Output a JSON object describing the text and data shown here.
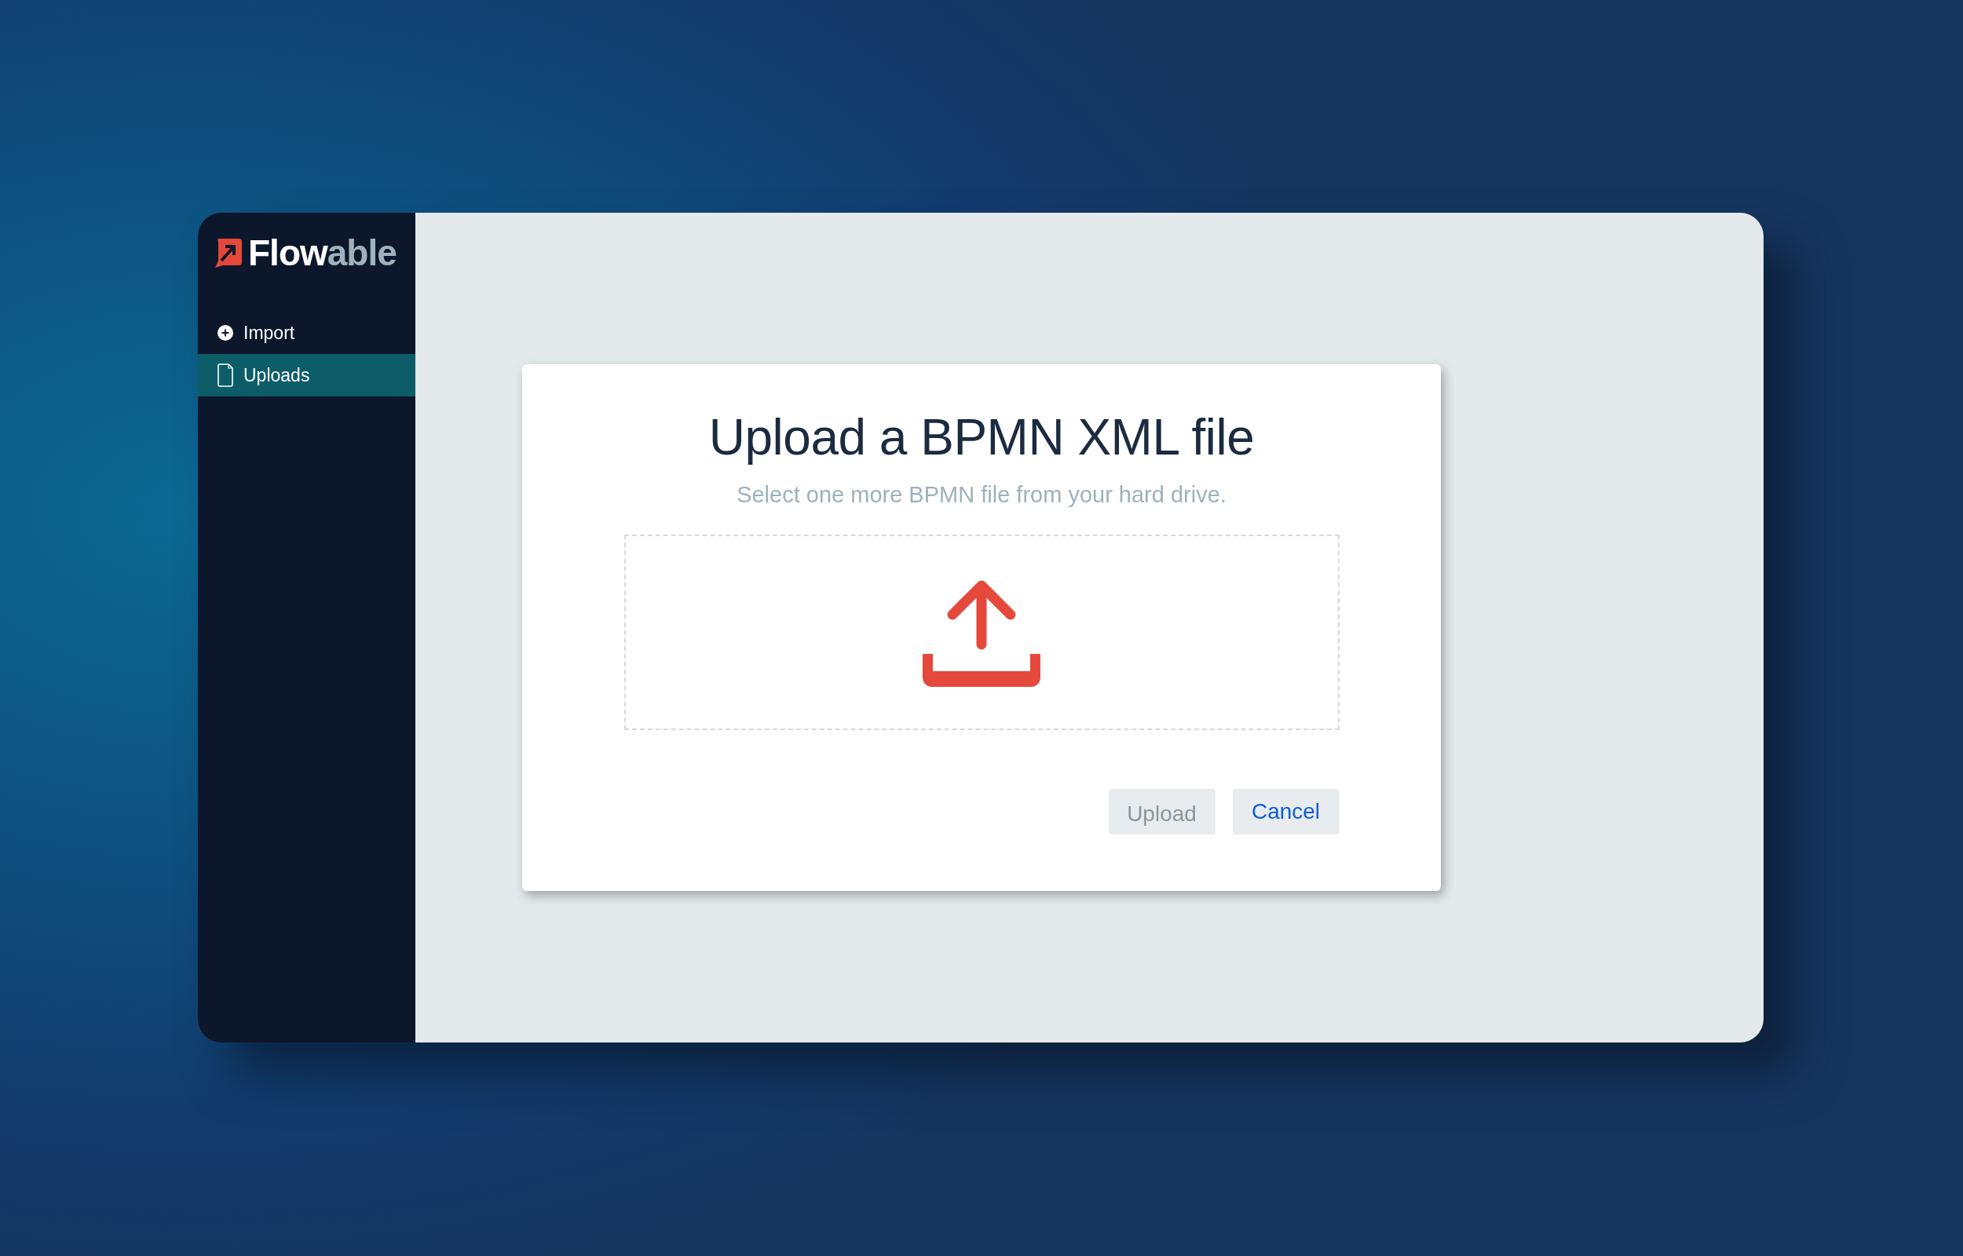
{
  "logo": {
    "first": "Flow",
    "second": "able"
  },
  "sidebar": {
    "items": [
      {
        "label": "Import",
        "kind": "add",
        "selected": false
      },
      {
        "label": "Uploads",
        "kind": "file",
        "selected": true
      }
    ]
  },
  "dialog": {
    "title": "Upload a BPMN XML file",
    "subtitle": "Select one more BPMN file from your hard drive.",
    "buttons": [
      {
        "label": "Upload",
        "disabled": true
      },
      {
        "label": "Cancel",
        "disabled": false
      }
    ]
  }
}
